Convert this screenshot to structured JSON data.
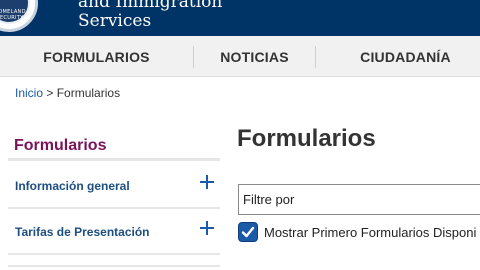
{
  "header": {
    "agency_line1": "and Immigration",
    "agency_line2": "Services",
    "seal_text": "HOMELAND SECURITY",
    "background_color": "#003366"
  },
  "nav": {
    "items": [
      {
        "label": "FORMULARIOS"
      },
      {
        "label": "NOTICIAS"
      },
      {
        "label": "CIUDADANÍA"
      }
    ]
  },
  "breadcrumb": {
    "home": "Inicio",
    "separator": ">",
    "current": "Formularios"
  },
  "sidebar": {
    "title": "Formularios",
    "title_color": "#7a1459",
    "items": [
      {
        "label": "Información general",
        "icon": "plus-icon"
      },
      {
        "label": "Tarifas de Presentación",
        "icon": "plus-icon"
      }
    ]
  },
  "main": {
    "title": "Formularios",
    "filter_placeholder": "Filtre por",
    "checkbox_label": "Mostrar Primero Formularios Disponi",
    "checkbox_checked": true
  },
  "colors": {
    "link": "#1a5aa6",
    "accent": "#7a1459"
  }
}
